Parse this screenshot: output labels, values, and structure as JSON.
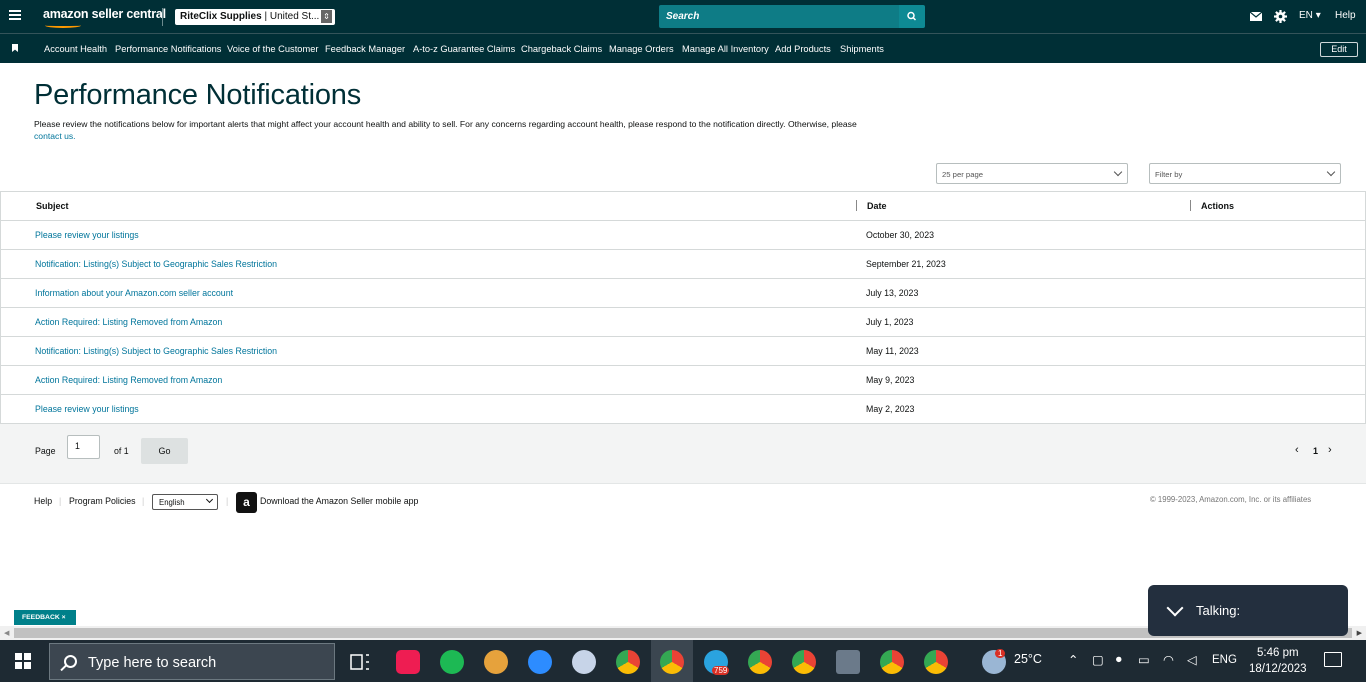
{
  "header": {
    "logo_text": "amazon seller central",
    "store_name": "RiteClix Supplies",
    "store_region": "| United St...",
    "search_placeholder": "Search",
    "language": "EN",
    "help": "Help"
  },
  "nav": {
    "items": [
      "Account Health",
      "Performance Notifications",
      "Voice of the Customer",
      "Feedback Manager",
      "A-to-z Guarantee Claims",
      "Chargeback Claims",
      "Manage Orders",
      "Manage All Inventory",
      "Add Products",
      "Shipments"
    ],
    "edit_label": "Edit"
  },
  "page": {
    "title": "Performance Notifications",
    "description": "Please review the notifications below for important alerts that might affect your account health and ability to sell. For any concerns regarding account health, please respond to the notification directly. Otherwise, please",
    "contact_link": "contact us."
  },
  "controls": {
    "per_page": "25 per page",
    "filter_placeholder": "Filter by"
  },
  "table": {
    "headers": [
      "Subject",
      "Date",
      "Actions"
    ],
    "rows": [
      {
        "subject": "Please review your listings",
        "date": "October 30, 2023"
      },
      {
        "subject": "Notification: Listing(s) Subject to Geographic Sales Restriction",
        "date": "September 21, 2023"
      },
      {
        "subject": "Information about your Amazon.com seller account",
        "date": "July 13, 2023"
      },
      {
        "subject": "Action Required: Listing Removed from Amazon",
        "date": "July 1, 2023"
      },
      {
        "subject": "Notification: Listing(s) Subject to Geographic Sales Restriction",
        "date": "May 11, 2023"
      },
      {
        "subject": "Action Required: Listing Removed from Amazon",
        "date": "May 9, 2023"
      },
      {
        "subject": "Please review your listings",
        "date": "May 2, 2023"
      }
    ]
  },
  "pagination": {
    "page_label": "Page",
    "page_value": "1",
    "of_label": "of 1",
    "go_label": "Go",
    "current_page": "1"
  },
  "footer": {
    "help": "Help",
    "program_policies": "Program Policies",
    "language": "English",
    "app_text": "Download the Amazon Seller mobile app",
    "copyright": "© 1999-2023, Amazon.com, Inc. or its affiliates"
  },
  "feedback_tab": "FEEDBACK ×",
  "talking_popup": "Talking:",
  "taskbar": {
    "search_placeholder": "Type here to search",
    "telegram_badge": "759",
    "weather_badge": "1",
    "temperature": "25°C",
    "language": "ENG",
    "time": "5:46 pm",
    "date": "18/12/2023",
    "icons": [
      "task-view-icon",
      "tiktok-icon",
      "spotify-icon",
      "game-icon",
      "zoom-icon",
      "paint-icon",
      "chrome-icon",
      "chrome-icon",
      "telegram-icon",
      "chrome-icon",
      "chrome-icon",
      "calculator-icon",
      "chrome-icon",
      "chrome-icon"
    ]
  },
  "colors": {
    "header_bg": "#002f36",
    "link": "#00759b",
    "search_bg": "#0e7c86",
    "feedback_bg": "#00808a",
    "taskbar_bg": "#1e2a33"
  }
}
